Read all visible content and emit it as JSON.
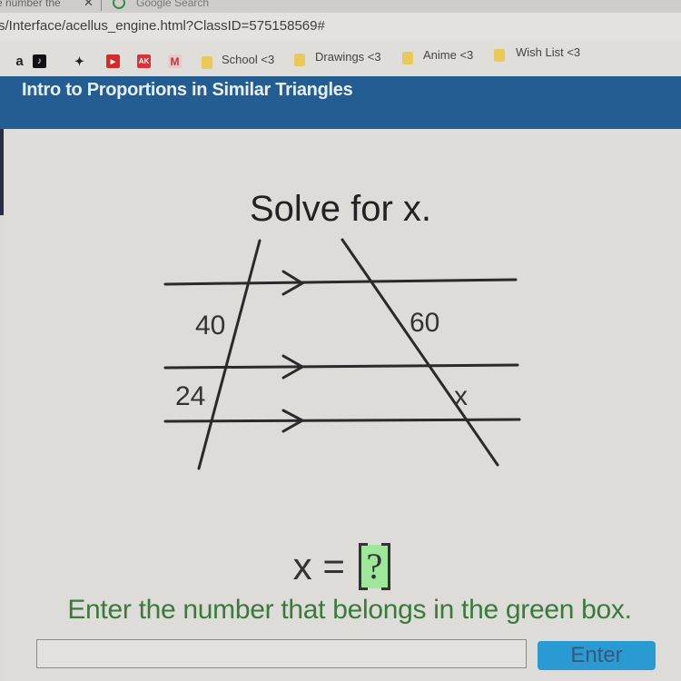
{
  "browser": {
    "active_tab_title": "e number the",
    "second_tab_title": "Google Search",
    "url": "s/Interface/acellus_engine.html?ClassID=575158569#"
  },
  "bookmarks": [
    {
      "icon": "amazon-icon",
      "glyph": "a",
      "color": "#1a1a1a"
    },
    {
      "icon": "tiktok-icon",
      "glyph": "♪",
      "color": "#111111"
    },
    {
      "icon": "animal-icon",
      "glyph": "✦",
      "color": "#222222"
    },
    {
      "icon": "youtube-icon",
      "glyph": "▶",
      "color": "#d42b2b"
    },
    {
      "icon": "ak-icon",
      "glyph": "AK",
      "color": "#d9333a"
    },
    {
      "icon": "m-icon",
      "glyph": "M",
      "color": "#c9323a"
    },
    {
      "icon": "folder-icon",
      "label": "School <3"
    },
    {
      "icon": "folder-icon",
      "label": "Drawings <3"
    },
    {
      "icon": "folder-icon",
      "label": "Anime <3"
    },
    {
      "icon": "folder-icon",
      "label": "Wish List <3"
    }
  ],
  "header": {
    "title": "Intro to Proportions in Similar Triangles"
  },
  "problem": {
    "prompt": "Solve for x.",
    "figure_labels": {
      "left_top_segment": "40",
      "left_bottom_segment": "24",
      "right_top_segment": "60",
      "right_bottom_segment": "x"
    },
    "equation_lhs": "x =",
    "answer_box": "?",
    "instruction": "Enter the number that belongs in the green box."
  },
  "answer": {
    "input_value": "",
    "input_placeholder": "",
    "submit_label": "Enter"
  },
  "colors": {
    "header_blue": "#235d92",
    "answer_box_green": "#9ee79a",
    "instruction_green": "#3a7a3a",
    "button_blue": "#2a9bd2"
  }
}
